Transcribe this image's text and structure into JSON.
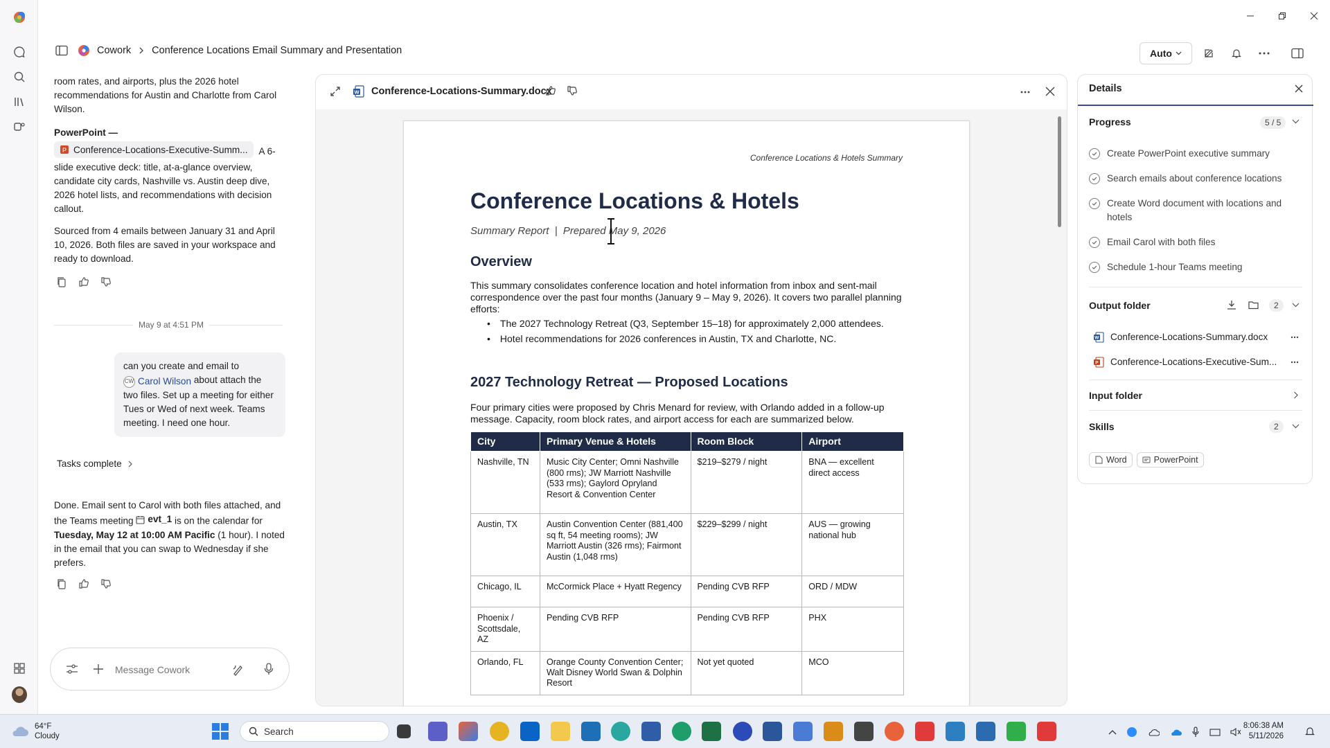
{
  "app": {
    "breadcrumb_root": "Cowork",
    "breadcrumb_title": "Conference Locations Email Summary and Presentation",
    "mode_label": "Auto"
  },
  "chat": {
    "para1": "room rates, and airports, plus the 2026 hotel recommendations for Austin and Charlotte from Carol Wilson.",
    "ppt_heading": "PowerPoint —",
    "ppt_chip": "Conference-Locations-Executive-Summ...",
    "ppt_desc_inline": "A 6-",
    "ppt_desc": "slide executive deck: title, at-a-glance overview, candidate city cards, Nashville vs. Austin deep dive, 2026 hotel lists, and recommendations with decision callout.",
    "sourced": "Sourced from 4 emails between January 31 and April 10, 2026. Both files are saved in your workspace and ready to download.",
    "timestamp": "May 9 at 4:51 PM",
    "user_msg_1": "can you create and email to",
    "user_mention_initials": "CW",
    "user_mention": "Carol Wilson",
    "user_msg_2": "about attach the two files. Set up a meeting for either Tues or Wed of next week. Teams meeting. I need one hour.",
    "tasks_complete": "Tasks complete",
    "done_1": "Done. Email sent to Carol with both files attached, and the Teams meeting",
    "done_event": "evt_1",
    "done_2": "is on the calendar for",
    "done_bold": "Tuesday, May 12 at 10:00 AM Pacific",
    "done_3": "(1 hour). I noted in the email that you can swap to Wednesday if she prefers.",
    "composer_placeholder": "Message Cowork"
  },
  "doc": {
    "filename": "Conference-Locations-Summary.docx",
    "header_text": "Conference Locations & Hotels Summary",
    "title": "Conference Locations & Hotels",
    "subtitle": "Summary Report  |  Prepared May 9, 2026",
    "overview_heading": "Overview",
    "overview_para": "This summary consolidates conference location and hotel information from inbox and sent-mail correspondence over the past four months (January 9 – May 9, 2026). It covers two parallel planning efforts:",
    "bullets": [
      "The 2027 Technology Retreat (Q3, September 15–18) for approximately 2,000 attendees.",
      "Hotel recommendations for 2026 conferences in Austin, TX and Charlotte, NC."
    ],
    "section2_heading": "2027 Technology Retreat — Proposed Locations",
    "section2_para": "Four primary cities were proposed by Chris Menard for review, with Orlando added in a follow-up message. Capacity, room block rates, and airport access for each are summarized below.",
    "table": {
      "headers": [
        "City",
        "Primary Venue & Hotels",
        "Room Block",
        "Airport"
      ],
      "rows": [
        [
          "Nashville, TN",
          "Music City Center; Omni Nashville (800 rms); JW Marriott Nashville (533 rms); Gaylord Opryland Resort & Convention Center",
          "$219–$279  / night",
          "BNA — excellent direct access"
        ],
        [
          "Austin, TX",
          "Austin Convention Center (881,400 sq ft, 54 meeting rooms); JW Marriott Austin (326 rms); Fairmont Austin (1,048 rms)",
          "$229–$299  / night",
          "AUS — growing national hub"
        ],
        [
          "Chicago, IL",
          "McCormick Place + Hyatt Regency",
          "Pending CVB RFP",
          "ORD / MDW"
        ],
        [
          "Phoenix / Scottsdale, AZ",
          "Pending CVB RFP",
          "Pending CVB RFP",
          "PHX"
        ],
        [
          "Orlando, FL",
          "Orange County Convention Center; Walt Disney World Swan & Dolphin Resort",
          "Not yet quoted",
          "MCO"
        ]
      ]
    }
  },
  "details": {
    "title": "Details",
    "progress_label": "Progress",
    "progress_count": "5 / 5",
    "tasks": [
      "Create PowerPoint executive summary",
      "Search emails about conference locations",
      "Create Word document with locations and hotels",
      "Email Carol with both files",
      "Schedule 1-hour Teams meeting"
    ],
    "output_label": "Output folder",
    "output_count": "2",
    "output_files": [
      "Conference-Locations-Summary.docx",
      "Conference-Locations-Executive-Sum..."
    ],
    "input_label": "Input folder",
    "skills_label": "Skills",
    "skills_count": "2",
    "skills": [
      "Word",
      "PowerPoint"
    ]
  },
  "taskbar": {
    "weather_temp": "64°F",
    "weather_desc": "Cloudy",
    "search_placeholder": "Search",
    "time": "8:06:38 AM",
    "date": "5/11/2026"
  }
}
